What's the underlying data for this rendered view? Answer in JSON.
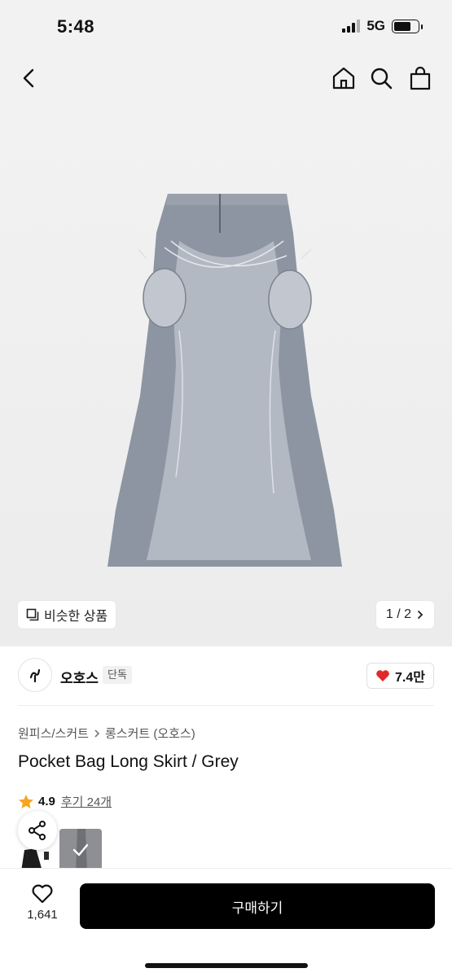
{
  "status_bar": {
    "time": "5:48",
    "network": "5G"
  },
  "nav": {
    "icons": [
      "back-arrow-icon",
      "home-icon",
      "search-icon",
      "shopping-bag-icon"
    ]
  },
  "gallery": {
    "similar_label": "비슷한 상품",
    "page_indicator": "1 / 2"
  },
  "seller": {
    "name": "오호스",
    "badge": "단독",
    "likes": "7.4만"
  },
  "product": {
    "breadcrumb": [
      "원피스/스커트",
      "롱스커트 (오호스)"
    ],
    "title": "Pocket Bag Long Skirt / Grey",
    "rating": "4.9",
    "review_link": "후기 24개"
  },
  "bottom": {
    "wish_count": "1,641",
    "buy_label": "구매하기"
  },
  "colors": {
    "accent": "#000000",
    "heart": "#e02a2a",
    "star": "#f5a623",
    "background": "#f2f2f2"
  }
}
